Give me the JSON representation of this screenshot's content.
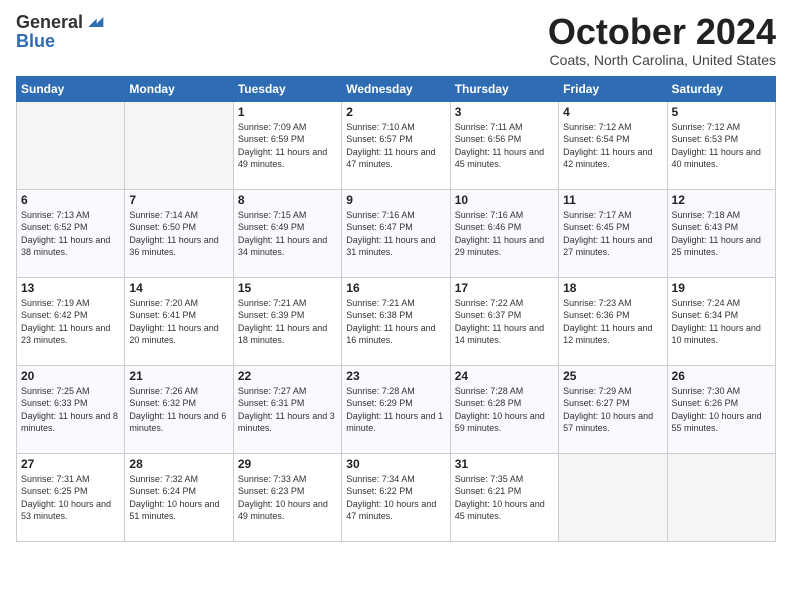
{
  "header": {
    "logo_line1": "General",
    "logo_line2": "Blue",
    "month": "October 2024",
    "location": "Coats, North Carolina, United States"
  },
  "weekdays": [
    "Sunday",
    "Monday",
    "Tuesday",
    "Wednesday",
    "Thursday",
    "Friday",
    "Saturday"
  ],
  "weeks": [
    [
      {
        "day": "",
        "info": ""
      },
      {
        "day": "",
        "info": ""
      },
      {
        "day": "1",
        "info": "Sunrise: 7:09 AM\nSunset: 6:59 PM\nDaylight: 11 hours and 49 minutes."
      },
      {
        "day": "2",
        "info": "Sunrise: 7:10 AM\nSunset: 6:57 PM\nDaylight: 11 hours and 47 minutes."
      },
      {
        "day": "3",
        "info": "Sunrise: 7:11 AM\nSunset: 6:56 PM\nDaylight: 11 hours and 45 minutes."
      },
      {
        "day": "4",
        "info": "Sunrise: 7:12 AM\nSunset: 6:54 PM\nDaylight: 11 hours and 42 minutes."
      },
      {
        "day": "5",
        "info": "Sunrise: 7:12 AM\nSunset: 6:53 PM\nDaylight: 11 hours and 40 minutes."
      }
    ],
    [
      {
        "day": "6",
        "info": "Sunrise: 7:13 AM\nSunset: 6:52 PM\nDaylight: 11 hours and 38 minutes."
      },
      {
        "day": "7",
        "info": "Sunrise: 7:14 AM\nSunset: 6:50 PM\nDaylight: 11 hours and 36 minutes."
      },
      {
        "day": "8",
        "info": "Sunrise: 7:15 AM\nSunset: 6:49 PM\nDaylight: 11 hours and 34 minutes."
      },
      {
        "day": "9",
        "info": "Sunrise: 7:16 AM\nSunset: 6:47 PM\nDaylight: 11 hours and 31 minutes."
      },
      {
        "day": "10",
        "info": "Sunrise: 7:16 AM\nSunset: 6:46 PM\nDaylight: 11 hours and 29 minutes."
      },
      {
        "day": "11",
        "info": "Sunrise: 7:17 AM\nSunset: 6:45 PM\nDaylight: 11 hours and 27 minutes."
      },
      {
        "day": "12",
        "info": "Sunrise: 7:18 AM\nSunset: 6:43 PM\nDaylight: 11 hours and 25 minutes."
      }
    ],
    [
      {
        "day": "13",
        "info": "Sunrise: 7:19 AM\nSunset: 6:42 PM\nDaylight: 11 hours and 23 minutes."
      },
      {
        "day": "14",
        "info": "Sunrise: 7:20 AM\nSunset: 6:41 PM\nDaylight: 11 hours and 20 minutes."
      },
      {
        "day": "15",
        "info": "Sunrise: 7:21 AM\nSunset: 6:39 PM\nDaylight: 11 hours and 18 minutes."
      },
      {
        "day": "16",
        "info": "Sunrise: 7:21 AM\nSunset: 6:38 PM\nDaylight: 11 hours and 16 minutes."
      },
      {
        "day": "17",
        "info": "Sunrise: 7:22 AM\nSunset: 6:37 PM\nDaylight: 11 hours and 14 minutes."
      },
      {
        "day": "18",
        "info": "Sunrise: 7:23 AM\nSunset: 6:36 PM\nDaylight: 11 hours and 12 minutes."
      },
      {
        "day": "19",
        "info": "Sunrise: 7:24 AM\nSunset: 6:34 PM\nDaylight: 11 hours and 10 minutes."
      }
    ],
    [
      {
        "day": "20",
        "info": "Sunrise: 7:25 AM\nSunset: 6:33 PM\nDaylight: 11 hours and 8 minutes."
      },
      {
        "day": "21",
        "info": "Sunrise: 7:26 AM\nSunset: 6:32 PM\nDaylight: 11 hours and 6 minutes."
      },
      {
        "day": "22",
        "info": "Sunrise: 7:27 AM\nSunset: 6:31 PM\nDaylight: 11 hours and 3 minutes."
      },
      {
        "day": "23",
        "info": "Sunrise: 7:28 AM\nSunset: 6:29 PM\nDaylight: 11 hours and 1 minute."
      },
      {
        "day": "24",
        "info": "Sunrise: 7:28 AM\nSunset: 6:28 PM\nDaylight: 10 hours and 59 minutes."
      },
      {
        "day": "25",
        "info": "Sunrise: 7:29 AM\nSunset: 6:27 PM\nDaylight: 10 hours and 57 minutes."
      },
      {
        "day": "26",
        "info": "Sunrise: 7:30 AM\nSunset: 6:26 PM\nDaylight: 10 hours and 55 minutes."
      }
    ],
    [
      {
        "day": "27",
        "info": "Sunrise: 7:31 AM\nSunset: 6:25 PM\nDaylight: 10 hours and 53 minutes."
      },
      {
        "day": "28",
        "info": "Sunrise: 7:32 AM\nSunset: 6:24 PM\nDaylight: 10 hours and 51 minutes."
      },
      {
        "day": "29",
        "info": "Sunrise: 7:33 AM\nSunset: 6:23 PM\nDaylight: 10 hours and 49 minutes."
      },
      {
        "day": "30",
        "info": "Sunrise: 7:34 AM\nSunset: 6:22 PM\nDaylight: 10 hours and 47 minutes."
      },
      {
        "day": "31",
        "info": "Sunrise: 7:35 AM\nSunset: 6:21 PM\nDaylight: 10 hours and 45 minutes."
      },
      {
        "day": "",
        "info": ""
      },
      {
        "day": "",
        "info": ""
      }
    ]
  ]
}
